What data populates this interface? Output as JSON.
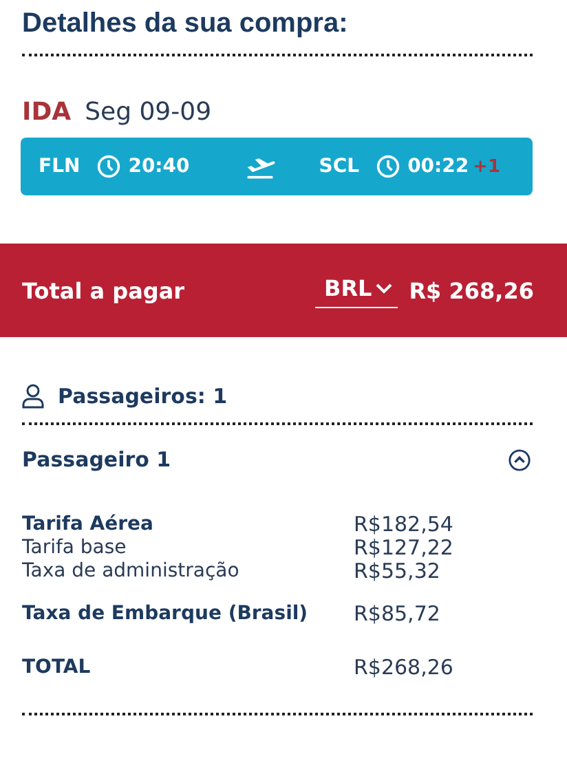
{
  "title": "Detalhes da sua compra:",
  "flight": {
    "direction": "IDA",
    "date": "Seg 09-09",
    "origin": "FLN",
    "departure": "20:40",
    "destination": "SCL",
    "arrival": "00:22",
    "day_offset": "+1"
  },
  "total_bar": {
    "label": "Total a pagar",
    "currency": "BRL",
    "amount": "R$ 268,26"
  },
  "passengers": {
    "label": "Passageiros: 1"
  },
  "passenger": {
    "label": "Passageiro 1",
    "expanded": true,
    "lines": [
      {
        "kind": "main",
        "label": "Tarifa Aérea",
        "value": "R$182,54"
      },
      {
        "kind": "sub",
        "label": "Tarifa base",
        "value": "R$127,22"
      },
      {
        "kind": "sub",
        "label": "Taxa de administração",
        "value": "R$55,32"
      },
      {
        "kind": "main",
        "label": "Taxa de Embarque (Brasil)",
        "value": "R$85,72"
      },
      {
        "kind": "total",
        "label": "TOTAL",
        "value": "R$268,26"
      }
    ]
  }
}
